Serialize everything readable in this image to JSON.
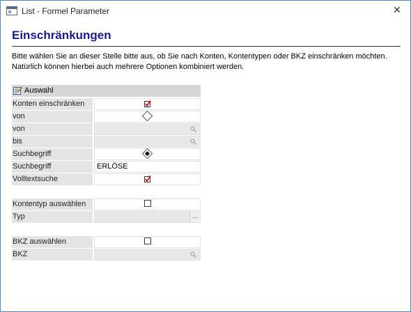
{
  "window": {
    "title": "List - Formel Parameter",
    "close_glyph": "✕"
  },
  "heading": "Einschränkungen",
  "description": "Bitte wählen Sie an dieser Stelle bitte aus, ob Sie nach Konten, Kontentypen oder BKZ einschränken möchten. Natürlich können hierbei auch mehrere Optionen kombiniert werden.",
  "section": {
    "title": "Auswahl",
    "icon": "edit-list-icon"
  },
  "rows": {
    "konten_einschraenken": {
      "label": "Konten einschränken",
      "checked": true
    },
    "von_radio": {
      "label": "von",
      "selected": false
    },
    "von_field": {
      "label": "von",
      "value": ""
    },
    "bis_field": {
      "label": "bis",
      "value": ""
    },
    "suchbegriff_radio": {
      "label": "Suchbegriff",
      "selected": true
    },
    "suchbegriff_field": {
      "label": "Suchbegriff",
      "value": "ERLÖSE"
    },
    "volltextsuche": {
      "label": "Volltextsuche",
      "checked": true
    },
    "kontentyp_auswaehlen": {
      "label": "Kontentyp auswählen",
      "checked": false
    },
    "typ": {
      "label": "Typ",
      "value": "",
      "button_label": "..."
    },
    "bkz_auswaehlen": {
      "label": "BKZ auswählen",
      "checked": false
    },
    "bkz": {
      "label": "BKZ",
      "value": ""
    }
  },
  "colors": {
    "heading": "#1a1a8c",
    "check": "#cc0000",
    "label_bg": "#e4e4e4",
    "header_bg": "#d6d6d6"
  }
}
